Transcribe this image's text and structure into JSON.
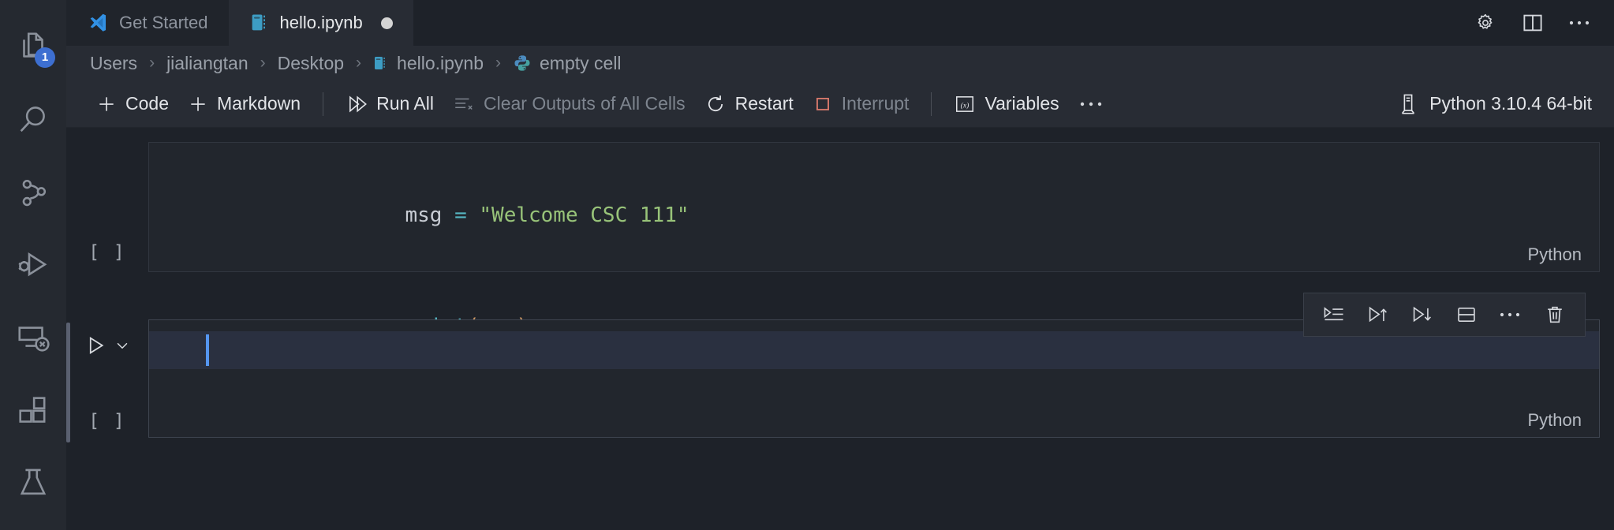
{
  "colors": {
    "accent_blue": "#3d6fd1",
    "cursor_blue": "#5596f0",
    "editor_bg": "#22262d",
    "chrome_bg": "#282c34",
    "activity_bg": "#252930",
    "string_green": "#98c379",
    "function_cyan": "#56b6c2",
    "paren_orange": "#d19a66",
    "variable_gray": "#c8ccd4",
    "interrupt_red": "#d97a6c"
  },
  "activity_bar": {
    "items": [
      {
        "name": "explorer",
        "icon": "files-icon",
        "badge": "1"
      },
      {
        "name": "search",
        "icon": "search-icon",
        "badge": ""
      },
      {
        "name": "source-control",
        "icon": "source-control-icon",
        "badge": ""
      },
      {
        "name": "run-and-debug",
        "icon": "run-debug-icon",
        "badge": ""
      },
      {
        "name": "remote-explorer",
        "icon": "remote-explorer-icon",
        "badge": ""
      },
      {
        "name": "extensions",
        "icon": "extensions-icon",
        "badge": ""
      },
      {
        "name": "testing",
        "icon": "beaker-icon",
        "badge": ""
      }
    ]
  },
  "tabs": [
    {
      "label": "Get Started",
      "icon": "vscode-logo-icon",
      "active": false,
      "dirty": false
    },
    {
      "label": "hello.ipynb",
      "icon": "notebook-icon",
      "active": true,
      "dirty": true
    }
  ],
  "tabbar_actions": [
    {
      "label": "Settings",
      "icon": "gear-icon"
    },
    {
      "label": "Split Editor",
      "icon": "split-editor-icon"
    },
    {
      "label": "More Actions...",
      "icon": "ellipsis-icon"
    }
  ],
  "breadcrumb": {
    "items": [
      {
        "label": "Users",
        "icon": ""
      },
      {
        "label": "jialiangtan",
        "icon": ""
      },
      {
        "label": "Desktop",
        "icon": ""
      },
      {
        "label": "hello.ipynb",
        "icon": "notebook-icon"
      },
      {
        "label": "empty cell",
        "icon": "python-icon"
      }
    ],
    "separator": "›"
  },
  "notebook_toolbar": {
    "buttons": [
      {
        "label": "Code",
        "icon": "plus-icon",
        "enabled": true
      },
      {
        "label": "Markdown",
        "icon": "plus-icon",
        "enabled": true
      },
      {
        "label": "Run All",
        "icon": "run-all-icon",
        "enabled": true
      },
      {
        "label": "Clear Outputs of All Cells",
        "icon": "clear-outputs-icon",
        "enabled": false
      },
      {
        "label": "Restart",
        "icon": "restart-icon",
        "enabled": true
      },
      {
        "label": "Interrupt",
        "icon": "stop-square-icon",
        "enabled": false
      },
      {
        "label": "Variables",
        "icon": "variables-icon",
        "enabled": true
      },
      {
        "label": "···",
        "icon": "ellipsis-icon",
        "enabled": true
      }
    ],
    "kernel": {
      "label": "Python 3.10.4 64-bit",
      "icon": "kernel-server-icon"
    }
  },
  "cells": [
    {
      "id": "cell-1",
      "execution_count": "[ ]",
      "language": "Python",
      "selected": false,
      "lines": [
        {
          "tokens": [
            {
              "text": "msg ",
              "color": "#c8ccd4"
            },
            {
              "text": "= ",
              "color": "#56b6c2"
            },
            {
              "text": "\"Welcome CSC 111\"",
              "color": "#98c379"
            }
          ]
        },
        {
          "tokens": [
            {
              "text": "print",
              "color": "#56b6c2"
            },
            {
              "text": "(",
              "color": "#d19a66"
            },
            {
              "text": "msg",
              "color": "#c8ccd4"
            },
            {
              "text": ")",
              "color": "#d19a66"
            }
          ]
        }
      ]
    },
    {
      "id": "cell-2",
      "execution_count": "[ ]",
      "language": "Python",
      "selected": true,
      "lines": [],
      "run_button": {
        "icon": "play-icon",
        "chevron": "chevron-down-icon"
      }
    }
  ],
  "cell_toolbar": {
    "actions": [
      {
        "label": "Execute Cell and Below",
        "icon": "execute-cell-list-icon"
      },
      {
        "label": "Execute Above Cells",
        "icon": "run-above-icon"
      },
      {
        "label": "Execute Cell and Below",
        "icon": "run-below-icon"
      },
      {
        "label": "Split Cell",
        "icon": "split-cell-icon"
      },
      {
        "label": "More Actions...",
        "icon": "ellipsis-icon"
      },
      {
        "label": "Delete Cell",
        "icon": "trash-icon"
      }
    ]
  }
}
